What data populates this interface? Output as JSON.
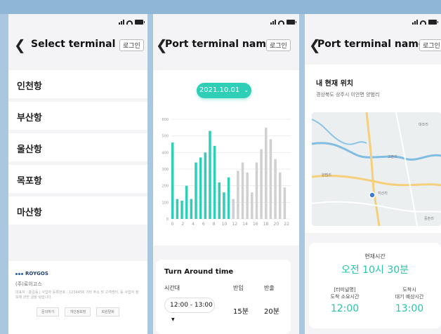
{
  "colors": {
    "accent": "#2ecfb6",
    "bar_active": "#2ecfb6",
    "bar_inactive": "#d0d0d0",
    "text": "#111111",
    "background": "#f4f4f6"
  },
  "screen1": {
    "title": "Select terminal",
    "login": "로그인",
    "terminals": [
      "인천항",
      "부산항",
      "울산항",
      "목포항",
      "마산항"
    ],
    "footer": {
      "logo": "ROYGOS",
      "company": "(주)로이고스",
      "fine": "대표자 : 홍길동 | 사업자 등록번호 : 1234456 기타 주소 및 고객센터, 등 사업자 정보에 관한 글을 넣습니다.",
      "links": [
        "문의하기",
        "개인정보방",
        "회원탈퇴"
      ]
    }
  },
  "screen2": {
    "title": "Port terminal name",
    "login": "로그인",
    "date": "2021.10.01",
    "turnaround": {
      "title": "Turn Around time",
      "col_time": "시간대",
      "col_in": "반입",
      "col_out": "반출",
      "time_value": "12:00 - 13:00",
      "in_value": "15분",
      "out_value": "20분"
    }
  },
  "screen3": {
    "title": "Port terminal name",
    "login": "로그인",
    "location_title": "내 현재 위치",
    "address": "경상북도 상주시 이안면 양범리",
    "map_labels": [
      "대조리",
      "고촌리",
      "양범리",
      "지산리",
      "중촌리"
    ],
    "current_time_label": "현재시간",
    "current_time": "오전 10시 30분",
    "arrival_label_1": "[터미널명]",
    "arrival_label_2": "도착 소요시간",
    "arrival_time": "12:00",
    "wait_label_1": "도착시",
    "wait_label_2": "대기 예상시간",
    "wait_time": "13:00"
  },
  "chart_data": {
    "type": "bar",
    "x": [
      0,
      0.9,
      1.8,
      2.7,
      3.6,
      4.5,
      5.4,
      6.3,
      7.2,
      8.1,
      9.0,
      9.9,
      10.8,
      11.7,
      12.6,
      13.5,
      14.4,
      15.3,
      16.2,
      17.1,
      18.0,
      18.9,
      19.8,
      20.7,
      21.6
    ],
    "values": [
      460,
      120,
      110,
      200,
      120,
      340,
      370,
      400,
      530,
      440,
      220,
      160,
      250,
      120,
      290,
      340,
      280,
      160,
      340,
      420,
      550,
      480,
      360,
      280,
      190
    ],
    "active_count": 13,
    "ylim": [
      0,
      600
    ],
    "yticks": [
      0,
      100,
      200,
      300,
      400,
      500,
      600
    ],
    "xticks": [
      0,
      2,
      4,
      6,
      8,
      10,
      12,
      14,
      16,
      18,
      20,
      22
    ],
    "title": "",
    "xlabel": "",
    "ylabel": "",
    "grid": true
  }
}
